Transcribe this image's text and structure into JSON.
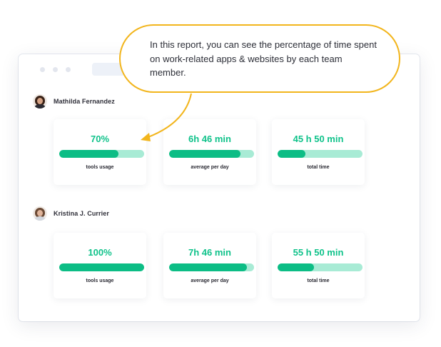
{
  "callout": {
    "text": "In this report, you can see the percentage of time spent on work-related apps & websites by each team member.",
    "border_color": "#f2b51c"
  },
  "colors": {
    "accent": "#0fc28a",
    "bar_fill": "#0cbd85",
    "bar_track": "#a8ebd5"
  },
  "members": [
    {
      "name": "Mathilda Fernandez",
      "stats": [
        {
          "value": "70%",
          "label": "tools usage",
          "progress": 0.7
        },
        {
          "value": "6h 46 min",
          "label": "average per day",
          "progress": 0.84
        },
        {
          "value": "45 h 50 min",
          "label": "total time",
          "progress": 0.33
        }
      ]
    },
    {
      "name": "Kristina J. Currier",
      "stats": [
        {
          "value": "100%",
          "label": "tools usage",
          "progress": 1.0
        },
        {
          "value": "7h 46 min",
          "label": "average per day",
          "progress": 0.92
        },
        {
          "value": "55 h 50 min",
          "label": "total time",
          "progress": 0.43
        }
      ]
    }
  ]
}
